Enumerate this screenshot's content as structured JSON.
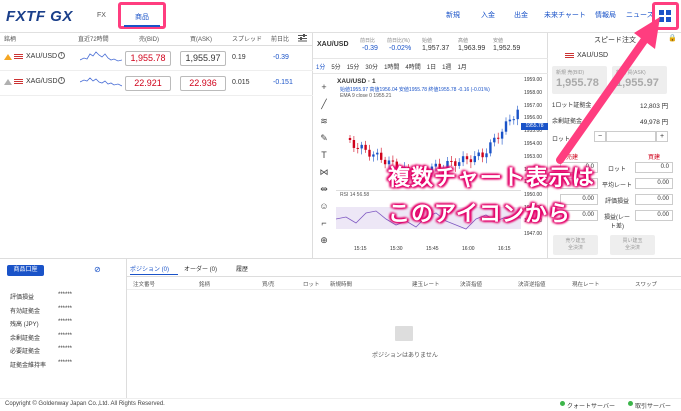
{
  "header": {
    "logo": "FXTF GX",
    "tab_fx": "FX",
    "tab_shohin": "商品",
    "nav": [
      "新規",
      "入金",
      "出金",
      "未来チャート",
      "情報局",
      "ニュース"
    ]
  },
  "accent": "#1a53c8",
  "highlight": "#ff3d7f",
  "table": {
    "headers": [
      "銘柄",
      "直近72時間",
      "売(BID)",
      "買(ASK)",
      "スプレッド",
      "前日比"
    ],
    "rows": [
      {
        "symbol": "XAU/USD",
        "bid": "1,955.78",
        "ask": "1,955.97",
        "spread": "0.19",
        "change": "-0.39"
      },
      {
        "symbol": "XAG/USD",
        "bid": "22.921",
        "ask": "22.936",
        "spread": "0.015",
        "change": "-0.151"
      }
    ]
  },
  "chart": {
    "symbol": "XAU/USD",
    "stats_labels": [
      "前日比",
      "前日比(%)",
      "始値",
      "高値",
      "安値"
    ],
    "stats_values": [
      "-0.39",
      "-0.02%",
      "1,957.37",
      "1,963.99",
      "1,952.59"
    ],
    "timeframes": [
      "1分",
      "5分",
      "15分",
      "30分",
      "1時間",
      "4時間",
      "1日",
      "1週",
      "1月"
    ],
    "title": "XAU/USD · 1",
    "ohlc": "始値1955.97 高値1956.04 安値1955.78 終値1955.78 -0.16 (-0.01%)",
    "ema": "EMA 9 close 0  1955.21",
    "rsi": "RSI 14  56.58",
    "yticks": [
      "1959.00",
      "1958.00",
      "1957.00",
      "1956.00",
      "1955.00",
      "1954.00",
      "1953.00",
      "1952.00",
      "1951.00",
      "1950.00",
      "1949.00",
      "1948.00",
      "1947.00"
    ],
    "price_tag": "1955.78",
    "xticks": [
      "15:15",
      "15:30",
      "15:45",
      "16:00",
      "16:15"
    ]
  },
  "speed": {
    "title": "スピード注文",
    "symbol": "XAU/USD",
    "new_sell_label": "新規 売(BID)",
    "new_buy_label": "新規 買(ASK)",
    "bid": "1,955.78",
    "ask": "1,955.97",
    "margin_label": "1ロット証拠金",
    "margin": "12,803 円",
    "free_label": "余剰証拠金",
    "free": "49,978 円",
    "lot_label": "ロット",
    "sell": "売建",
    "buy": "買建",
    "rows": [
      {
        "label": "ロット",
        "l": "0.0",
        "r": "0.0"
      },
      {
        "label": "平均レート",
        "l": "0.00",
        "r": "0.00"
      },
      {
        "label": "評価損益",
        "l": "0.00",
        "r": "0.00"
      },
      {
        "label": "損益(レート差)",
        "l": "0.00",
        "r": "0.00"
      }
    ],
    "close_sell": "売り建玉\n全決済",
    "close_buy": "買い建玉\n全決済"
  },
  "account": {
    "button": "商品口座",
    "rows": [
      {
        "label": "評価損益",
        "value": "******"
      },
      {
        "label": "有効証拠金",
        "value": "******"
      },
      {
        "label": "残高 (JPY)",
        "value": "******"
      },
      {
        "label": "余剰証拠金",
        "value": "******"
      },
      {
        "label": "必要証拠金",
        "value": "******"
      },
      {
        "label": "証拠金維持率",
        "value": "******"
      }
    ]
  },
  "positions": {
    "tabs": [
      "ポジション (0)",
      "オーダー (0)",
      "履歴"
    ],
    "headers": [
      "注文番号",
      "銘柄",
      "買/売",
      "ロット",
      "新規時間",
      "建玉レート",
      "決済指値",
      "決済逆指値",
      "現在レート",
      "スワップ"
    ],
    "empty": "ポジションはありません"
  },
  "footer": {
    "copyright": "Copyright © Goldenway Japan Co.,Ltd. All Rights Reserved.",
    "quote_server": "クォートサーバー",
    "trade_server": "取引サーバー"
  },
  "annotation": {
    "line1": "複数チャート表示は",
    "line2": "このアイコンから"
  }
}
